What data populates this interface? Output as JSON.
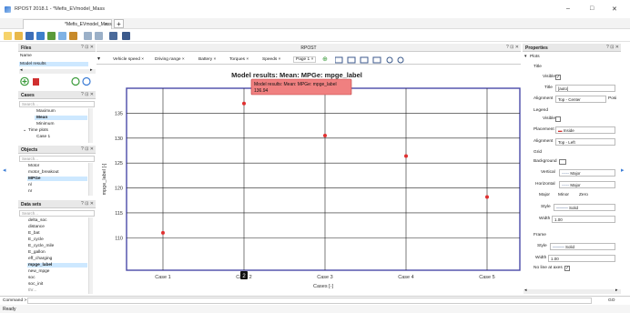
{
  "window": {
    "title": "RPOST 2018.1 - *Mefis_EVmodel_Mass",
    "minimize": "–",
    "maximize": "□",
    "close": "✕"
  },
  "tabs": {
    "document": "*Mefis_EVmodel_Mass",
    "close": "×",
    "add": "+"
  },
  "files_panel": {
    "title": "Files",
    "controls": "? ⊡ ✕",
    "name_header": "Name",
    "selected_file": "Model results",
    "scroll_left": "◂",
    "scroll_right": "▸"
  },
  "cases_panel": {
    "title": "Cases",
    "search_placeholder": "Search...",
    "items": [
      "Maximum",
      "Mean",
      "Minimum",
      "Time plots",
      "Case 1"
    ],
    "time_plots_toggle": "⌄"
  },
  "objects_panel": {
    "title": "Objects",
    "search_placeholder": "Search...",
    "items": [
      "Motor",
      "motor_breakout",
      "MPGe",
      "nl",
      "nr"
    ]
  },
  "datasets_panel": {
    "title": "Data sets",
    "search_placeholder": "Search...",
    "items": [
      "delta_soc",
      "distance",
      "E_bat",
      "E_cycle",
      "E_cycle_mile",
      "E_gallon",
      "eff_charging",
      "mpge_label",
      "new_mpge",
      "soc",
      "soc_init",
      "thr..."
    ]
  },
  "chart_header": {
    "title": "RPOST"
  },
  "chart_tabs": {
    "items": [
      "Vehicle speed",
      "Driving range",
      "Battery",
      "Torques",
      "Speeds",
      "Page 1"
    ],
    "close": "×",
    "add": "⊕"
  },
  "chart_data": {
    "type": "scatter",
    "title": "Model results: Mean: MPGe: mpge_label",
    "xlabel": "Cases [-]",
    "ylabel": "mpge_label [-]",
    "categories": [
      "Case 1",
      "Case 2",
      "Case 3",
      "Case 4",
      "Case 5"
    ],
    "values": [
      111,
      136.94,
      130.5,
      126.4,
      118.2
    ],
    "yticks": [
      110,
      115,
      120,
      125,
      130,
      135
    ],
    "ylim": [
      103.5,
      140
    ],
    "grid": true,
    "point_color": "#e03030",
    "tooltip": {
      "line1": "Model results: Mean: MPGe: mpge_label",
      "line2": "136.94"
    },
    "cursor_index": "2"
  },
  "properties_panel": {
    "title": "Properties",
    "controls": "? ⊡ ✕",
    "plots_label": "Plots",
    "title_section": "Title",
    "visible_label": "Visible",
    "title_label": "Title",
    "title_value": "[auto]",
    "alignment_label": "Alignment",
    "alignment_value": "Top - Center",
    "position_cut": "Posi",
    "legend_section": "Legend",
    "legend_visible_label": "Visible",
    "placement_label": "Placement",
    "placement_value": "Inside",
    "legend_alignment_label": "Alignment",
    "legend_alignment_value": "Top - Left",
    "grid_section": "Grid",
    "background_label": "Background",
    "vertical_label": "Vertical",
    "vertical_value": "Major",
    "horizontal_label": "Horizontal",
    "horizontal_value": "Major",
    "major_option": "Major",
    "minor_option": "Minor",
    "zero_option": "Zero",
    "style_label": "Style",
    "style_value": "Solid",
    "width_label": "Width",
    "width_value": "1.00",
    "frame_section": "Frame",
    "frame_style_label": "Style",
    "frame_style_value": "Solid",
    "frame_width_label": "Width",
    "frame_width_value": "1.00",
    "no_line_label": "No line at axes"
  },
  "command": {
    "label": "Command >",
    "go": "GO"
  },
  "status": {
    "text": "Ready"
  },
  "check_mark": "✓",
  "collapse_arrow": "⌃",
  "expand_arrow": "▾"
}
